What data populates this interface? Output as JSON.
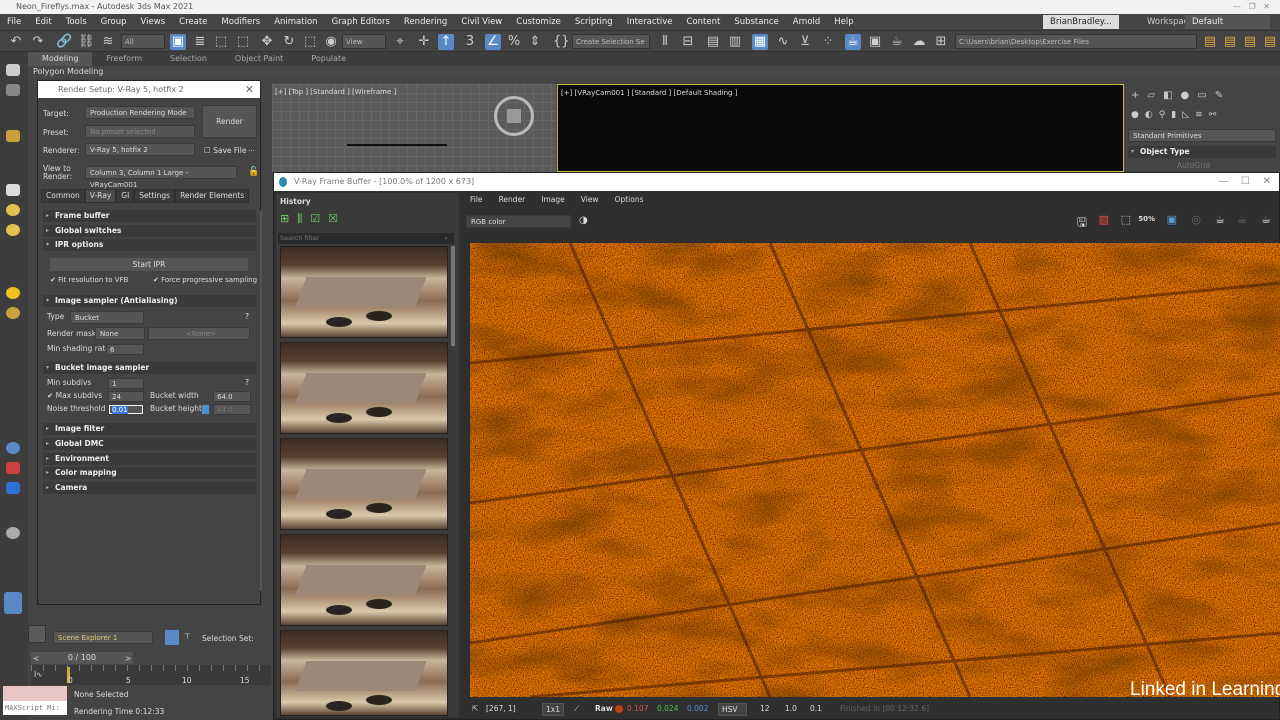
{
  "window": {
    "title": "Neon_Fireflys.max - Autodesk 3ds Max 2021"
  },
  "menu": [
    "File",
    "Edit",
    "Tools",
    "Group",
    "Views",
    "Create",
    "Modifiers",
    "Animation",
    "Graph Editors",
    "Rendering",
    "Civil View",
    "Customize",
    "Scripting",
    "Interactive",
    "Content",
    "Substance",
    "Arnold",
    "Help"
  ],
  "user": "BrianBradley...",
  "workspaces": {
    "label": "Workspaces:",
    "value": "Default"
  },
  "toolbar": {
    "filter": "All",
    "coord": "View",
    "selection_set": "Create Selection Se",
    "path": "C:\\Users\\brian\\Desktop\\Exercise Files"
  },
  "ribbon": {
    "tabs": [
      "Modeling",
      "Freeform",
      "Selection",
      "Object Paint",
      "Populate"
    ],
    "sub": "Polygon Modeling"
  },
  "render_setup": {
    "title": "Render Setup: V-Ray 5, hotfix 2",
    "target_label": "Target:",
    "target": "Production Rendering Mode",
    "preset_label": "Preset:",
    "preset": "No preset selected",
    "renderer_label": "Renderer:",
    "renderer": "V-Ray 5, hotfix 2",
    "save_file": "Save File",
    "more": "...",
    "view_label": "View to Render:",
    "view": "Column 3, Column 1 Large - VRayCam001",
    "render_button": "Render",
    "tabs": [
      "Common",
      "V-Ray",
      "GI",
      "Settings",
      "Render Elements"
    ],
    "rollouts": {
      "frame_buffer": "Frame buffer",
      "global_switches": "Global switches",
      "ipr": "IPR options",
      "image_sampler": "Image sampler (Antialiasing)",
      "bucket": "Bucket image sampler",
      "image_filter": "Image filter",
      "global_dmc": "Global DMC",
      "environment": "Environment",
      "color_mapping": "Color mapping",
      "camera": "Camera"
    },
    "start_ipr": "Start IPR",
    "fit_resolution": "Fit resolution to VFB",
    "force_progressive": "Force progressive sampling",
    "type_label": "Type",
    "type": "Bucket",
    "render_mask_label": "Render mask",
    "render_mask": "None",
    "render_mask_obj": "<None>",
    "min_shading_label": "Min shading rate",
    "min_shading": "6",
    "min_subdivs_label": "Min subdivs",
    "min_subdivs": "1",
    "max_subdivs_label": "Max subdivs",
    "max_subdivs": "24",
    "noise_label": "Noise threshold",
    "noise": "0.01",
    "bucket_width_label": "Bucket width",
    "bucket_width": "64.0",
    "bucket_height_label": "Bucket height",
    "bucket_height": "64.0",
    "help": "?"
  },
  "viewports": {
    "top": "[+] [Top ] [Standard ] [Wireframe ]",
    "camera": "[+] [VRayCam001 ] [Standard ] [Default Shading ]"
  },
  "command_panel": {
    "dropdown": "Standard Primitives",
    "rollout": "Object Type",
    "autogrid": "AutoGrid"
  },
  "vfb": {
    "title": "V-Ray Frame Buffer - [100.0% of 1200 x 673]",
    "history": "History",
    "search_placeholder": "Search filter",
    "menu": [
      "File",
      "Render",
      "Image",
      "View",
      "Options"
    ],
    "channel": "RGB color",
    "status": {
      "coords": "[267, 1]",
      "sampling": "1x1",
      "mode": "Raw",
      "r": "0.107",
      "g": "0.024",
      "b": "0.002",
      "space": "HSV",
      "h": "12",
      "s": "1.0",
      "v": "0.1",
      "finished": "Finished in [00:12:32.6]"
    },
    "colors": {
      "r": "#e05050",
      "g": "#50c050",
      "b": "#5090e0"
    }
  },
  "bottom": {
    "scene_explorer": "Scene Explorer 1",
    "selection_set": "Selection Set:",
    "time": "0 / 100",
    "ticks": [
      "0",
      "5",
      "10",
      "15"
    ],
    "none_selected": "None Selected",
    "rendering_time": "Rendering Time  0:12:33",
    "maxscript": "MAXScript Mi:"
  },
  "watermark": "Linked in Learning"
}
